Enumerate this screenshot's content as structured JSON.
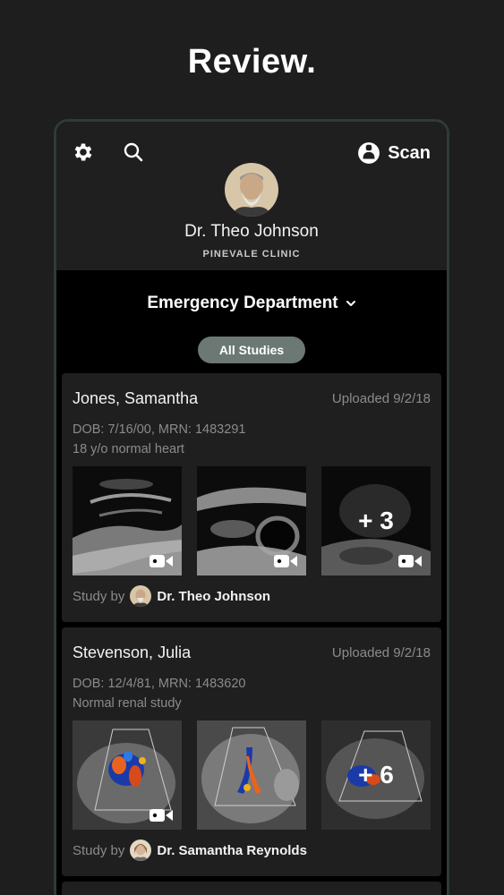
{
  "headline": "Review.",
  "header": {
    "settings_icon": "gear-icon",
    "search_icon": "search-icon",
    "scan_label": "Scan",
    "doctor_name": "Dr. Theo Johnson",
    "clinic": "PINEVALE CLINIC"
  },
  "department": {
    "label": "Emergency Department"
  },
  "filter": {
    "label": "All Studies"
  },
  "studies": [
    {
      "patient": "Jones, Samantha",
      "uploaded": "Uploaded 9/2/18",
      "dob_mrn": "DOB: 7/16/00, MRN: 1483291",
      "description": "18 y/o normal heart",
      "more_count": "+ 3",
      "study_by_label": "Study by",
      "study_by_name": "Dr. Theo Johnson"
    },
    {
      "patient": "Stevenson, Julia",
      "uploaded": "Uploaded 9/2/18",
      "dob_mrn": "DOB: 12/4/81, MRN: 1483620",
      "description": "Normal renal study",
      "more_count": "+ 6",
      "study_by_label": "Study by",
      "study_by_name": "Dr. Samantha Reynolds"
    }
  ],
  "colors": {
    "background": "#1e1e1e",
    "card": "#1f1f1f",
    "pill": "#6b7874",
    "muted": "#8b8b8b"
  }
}
